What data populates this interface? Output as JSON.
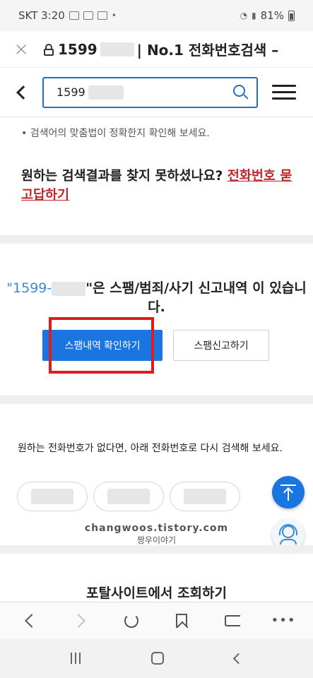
{
  "status_bar": {
    "carrier_time": "SKT 3:20",
    "dot": "•",
    "battery": "81%"
  },
  "browser": {
    "url_title_prefix": "1599",
    "url_title_suffix": "| No.1 전화번호검색 –",
    "close_glyph": "×"
  },
  "search": {
    "value_prefix": "1599"
  },
  "tip": "• 검색어의 맞춤법이 정확한지 확인해 보세요.",
  "not_found": {
    "text": "원하는 검색결과를 찾지 못하셨나요?",
    "link": "전화번호 묻고답하기"
  },
  "spam": {
    "quote_open": "\"",
    "number_prefix": "1599-",
    "message": "\"은 스팸/범죄/사기 신고내역 이 있습니다.",
    "primary_button": "스팸내역 확인하기",
    "secondary_button": "스팸신고하기"
  },
  "alternatives": {
    "text": "원하는 전화번호가 없다면, 아래 전화번호로 다시 검색해 보세요.",
    "chips": [
      "",
      "",
      ""
    ]
  },
  "watermark": {
    "line1": "changwoos.tistory.com",
    "line2": "짱우이야기"
  },
  "portal_title": "포탈사이트에서 조회하기",
  "toolbar": {
    "more_glyph": "•••"
  },
  "colors": {
    "accent": "#1a75e0",
    "link_red": "#c0262d",
    "highlight": "#e01b1b"
  }
}
